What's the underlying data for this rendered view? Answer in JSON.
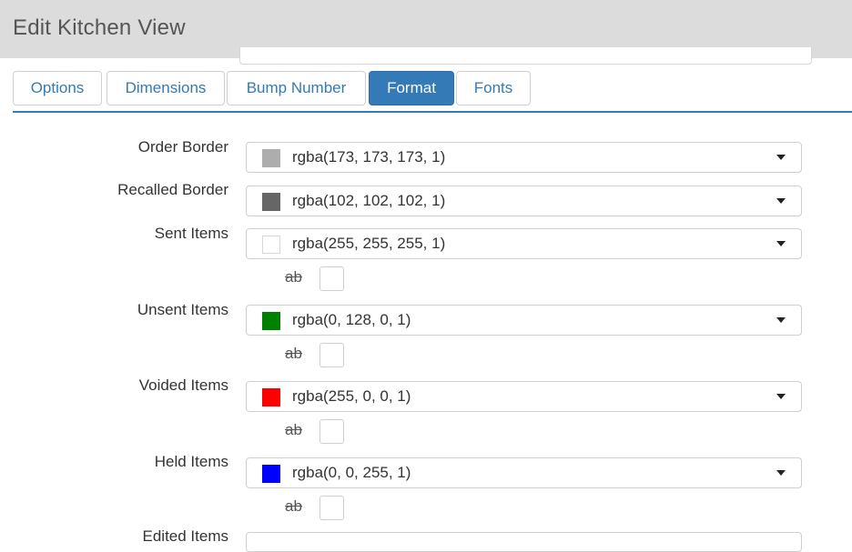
{
  "header": {
    "title": "Edit Kitchen View"
  },
  "tabs": [
    {
      "label": "Options"
    },
    {
      "label": "Dimensions"
    },
    {
      "label": "Bump Number"
    },
    {
      "label": "Format",
      "active": true
    },
    {
      "label": "Fonts"
    }
  ],
  "format": {
    "order_border": {
      "label": "Order Border",
      "value": "rgba(173, 173, 173, 1)",
      "color": "#adadad"
    },
    "recalled_border": {
      "label": "Recalled Border",
      "value": "rgba(102, 102, 102, 1)",
      "color": "#666666"
    },
    "sent_items": {
      "label": "Sent Items",
      "value": "rgba(255, 255, 255, 1)",
      "color": "#ffffff",
      "strike_label": "ab",
      "strike_checked": false
    },
    "unsent_items": {
      "label": "Unsent Items",
      "value": "rgba(0, 128, 0, 1)",
      "color": "#008000",
      "strike_label": "ab",
      "strike_checked": false
    },
    "voided_items": {
      "label": "Voided Items",
      "value": "rgba(255, 0, 0, 1)",
      "color": "#ff0000",
      "strike_label": "ab",
      "strike_checked": false
    },
    "held_items": {
      "label": "Held Items",
      "value": "rgba(0, 0, 255, 1)",
      "color": "#0000ff",
      "strike_label": "ab",
      "strike_checked": false
    },
    "edited_items": {
      "label": "Edited Items"
    }
  }
}
